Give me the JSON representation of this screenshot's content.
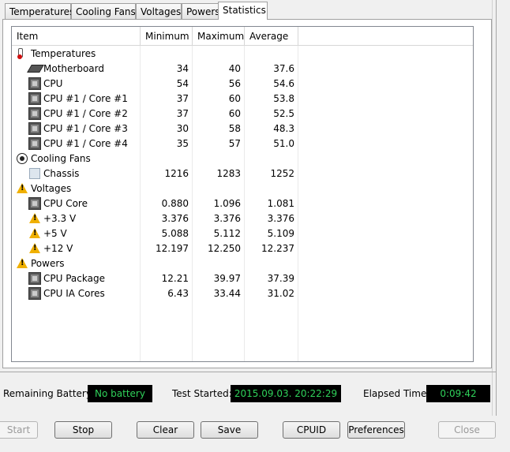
{
  "tabs": [
    {
      "label": "Temperatures",
      "active": false
    },
    {
      "label": "Cooling Fans",
      "active": false
    },
    {
      "label": "Voltages",
      "active": false
    },
    {
      "label": "Powers",
      "active": false
    },
    {
      "label": "Statistics",
      "active": true
    }
  ],
  "columns": {
    "item": "Item",
    "minimum": "Minimum",
    "maximum": "Maximum",
    "average": "Average"
  },
  "rows": [
    {
      "type": "group",
      "icon": "thermometer-icon",
      "label": "Temperatures"
    },
    {
      "type": "item",
      "icon": "motherboard-icon",
      "label": "Motherboard",
      "min": "34",
      "max": "40",
      "avg": "37.6"
    },
    {
      "type": "item",
      "icon": "cpu-icon",
      "label": "CPU",
      "min": "54",
      "max": "56",
      "avg": "54.6"
    },
    {
      "type": "item",
      "icon": "cpu-icon",
      "label": "CPU #1 / Core #1",
      "min": "37",
      "max": "60",
      "avg": "53.8"
    },
    {
      "type": "item",
      "icon": "cpu-icon",
      "label": "CPU #1 / Core #2",
      "min": "37",
      "max": "60",
      "avg": "52.5"
    },
    {
      "type": "item",
      "icon": "cpu-icon",
      "label": "CPU #1 / Core #3",
      "min": "30",
      "max": "58",
      "avg": "48.3"
    },
    {
      "type": "item",
      "icon": "cpu-icon",
      "label": "CPU #1 / Core #4",
      "min": "35",
      "max": "57",
      "avg": "51.0"
    },
    {
      "type": "group",
      "icon": "fan-icon",
      "label": "Cooling Fans"
    },
    {
      "type": "item",
      "icon": "chassis-icon",
      "label": "Chassis",
      "min": "1216",
      "max": "1283",
      "avg": "1252"
    },
    {
      "type": "group",
      "icon": "warning-icon",
      "label": "Voltages"
    },
    {
      "type": "item",
      "icon": "cpu-icon",
      "label": "CPU Core",
      "min": "0.880",
      "max": "1.096",
      "avg": "1.081"
    },
    {
      "type": "item",
      "icon": "warning-icon",
      "label": "+3.3 V",
      "min": "3.376",
      "max": "3.376",
      "avg": "3.376"
    },
    {
      "type": "item",
      "icon": "warning-icon",
      "label": "+5 V",
      "min": "5.088",
      "max": "5.112",
      "avg": "5.109"
    },
    {
      "type": "item",
      "icon": "warning-icon",
      "label": "+12 V",
      "min": "12.197",
      "max": "12.250",
      "avg": "12.237"
    },
    {
      "type": "group",
      "icon": "warning-icon",
      "label": "Powers"
    },
    {
      "type": "item",
      "icon": "cpu-icon",
      "label": "CPU Package",
      "min": "12.21",
      "max": "39.97",
      "avg": "37.39"
    },
    {
      "type": "item",
      "icon": "cpu-icon",
      "label": "CPU IA Cores",
      "min": "6.43",
      "max": "33.44",
      "avg": "31.02"
    }
  ],
  "status": {
    "battery_label": "Remaining Battery:",
    "battery_value": "No battery",
    "test_label": "Test Started:",
    "test_value": "2015.09.03. 20:22:29",
    "elapsed_label": "Elapsed Time:",
    "elapsed_value": "0:09:42"
  },
  "buttons": {
    "start": "Start",
    "stop": "Stop",
    "clear": "Clear",
    "save": "Save",
    "cpuid": "CPUID",
    "preferences": "Preferences",
    "close": "Close"
  },
  "colors": {
    "lcd_bg": "#000000",
    "lcd_text": "#2fd15a",
    "warning": "#f0b000"
  }
}
